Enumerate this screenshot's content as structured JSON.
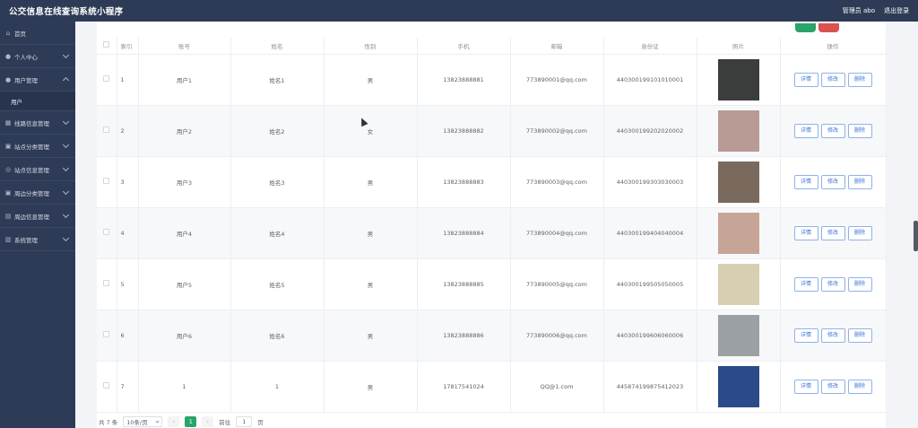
{
  "header": {
    "title": "公交信息在线查询系统小程序",
    "admin_label": "管理员 abo",
    "logout_label": "退出登录"
  },
  "sidebar": {
    "items": [
      {
        "label": "首页",
        "icon": "home-icon"
      },
      {
        "label": "个人中心",
        "icon": "user-icon"
      },
      {
        "label": "用户管理",
        "icon": "users-icon"
      },
      {
        "label": "用户",
        "icon": ""
      },
      {
        "label": "线路信息管理",
        "icon": "route-icon"
      },
      {
        "label": "站点分类管理",
        "icon": "category-icon"
      },
      {
        "label": "站点信息管理",
        "icon": "station-icon"
      },
      {
        "label": "周边分类管理",
        "icon": "category-icon"
      },
      {
        "label": "周边信息管理",
        "icon": "nearby-icon"
      },
      {
        "label": "系统管理",
        "icon": "system-icon"
      }
    ]
  },
  "table": {
    "headers": [
      "索引",
      "账号",
      "姓名",
      "性别",
      "手机",
      "邮箱",
      "身份证",
      "照片",
      "操作"
    ],
    "actions": {
      "detail": "详情",
      "edit": "修改",
      "delete": "删除"
    },
    "rows": [
      {
        "index": "1",
        "account": "用户1",
        "name": "姓名1",
        "gender": "男",
        "phone": "13823888881",
        "email": "773890001@qq.com",
        "idcard": "440300199101010001",
        "photo_color": "#3a3d3b"
      },
      {
        "index": "2",
        "account": "用户2",
        "name": "姓名2",
        "gender": "女",
        "phone": "13823888882",
        "email": "773890002@qq.com",
        "idcard": "440300199202020002",
        "photo_color": "#b89b95"
      },
      {
        "index": "3",
        "account": "用户3",
        "name": "姓名3",
        "gender": "男",
        "phone": "13823888883",
        "email": "773890003@qq.com",
        "idcard": "440300199303030003",
        "photo_color": "#7a6a5e"
      },
      {
        "index": "4",
        "account": "用户4",
        "name": "姓名4",
        "gender": "男",
        "phone": "13823888884",
        "email": "773890004@qq.com",
        "idcard": "440300199404040004",
        "photo_color": "#c7a596"
      },
      {
        "index": "5",
        "account": "用户5",
        "name": "姓名5",
        "gender": "男",
        "phone": "13823888885",
        "email": "773890005@qq.com",
        "idcard": "440300199505050005",
        "photo_color": "#d8cfb3"
      },
      {
        "index": "6",
        "account": "用户6",
        "name": "姓名6",
        "gender": "男",
        "phone": "13823888886",
        "email": "773890006@qq.com",
        "idcard": "440300199606060006",
        "photo_color": "#9aa0a3"
      },
      {
        "index": "7",
        "account": "1",
        "name": "1",
        "gender": "男",
        "phone": "17817541024",
        "email": "QQ@1.com",
        "idcard": "445874199875412023",
        "photo_color": "#2a4a8a"
      }
    ]
  },
  "pager": {
    "total": "共 7 条",
    "page_size": "10条/页",
    "prev": "‹",
    "current": "1",
    "next": "›",
    "goto_label": "前往",
    "goto_value": "1",
    "page_suffix": "页"
  }
}
